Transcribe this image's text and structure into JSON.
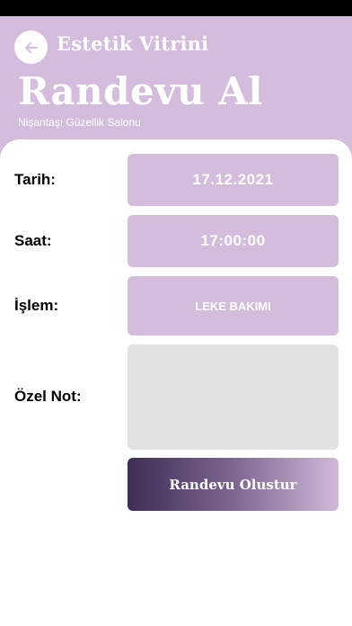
{
  "header": {
    "brand": "Estetik Vitrini",
    "title": "Randevu Al",
    "subtitle": "Nişantaşı Güzellik Salonu",
    "back_icon": "arrow-left-icon",
    "background_color": "#d4bcdc"
  },
  "form": {
    "date_label": "Tarih:",
    "date_value": "17.12.2021",
    "time_label": "Saat:",
    "time_value": "17:00:00",
    "service_label": "İşlem:",
    "service_value": "LEKE BAKIMI",
    "note_label": "Özel Not:",
    "note_value": "",
    "submit_label": "Randevu Olustur"
  },
  "colors": {
    "accent": "#d4bcdc",
    "note_background": "#e1e3e1",
    "button_gradient_start": "#3e2d57",
    "button_gradient_end": "#d2b9d9"
  }
}
